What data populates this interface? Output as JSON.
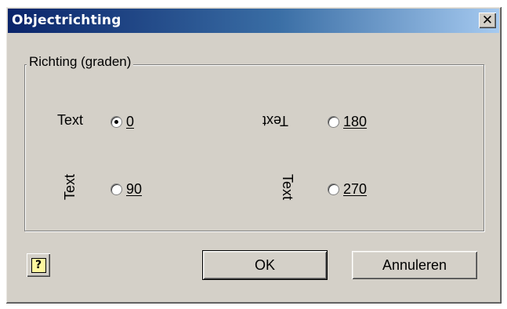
{
  "window": {
    "title": "Objectrichting",
    "close_glyph": "✕"
  },
  "group": {
    "label": "Richting (graden)",
    "sample_text": "Text",
    "options": [
      {
        "label": "0",
        "checked": true
      },
      {
        "label": "180",
        "checked": false
      },
      {
        "label": "90",
        "checked": false
      },
      {
        "label": "270",
        "checked": false
      }
    ]
  },
  "buttons": {
    "help_glyph": "?",
    "ok_label": "OK",
    "cancel_label": "Annuleren"
  },
  "icons": {
    "close": "close-icon",
    "help": "help-icon",
    "radio": "radio-icon"
  },
  "colors": {
    "title_start": "#0a246a",
    "title_end": "#a6caf0",
    "face": "#d4d0c8"
  }
}
